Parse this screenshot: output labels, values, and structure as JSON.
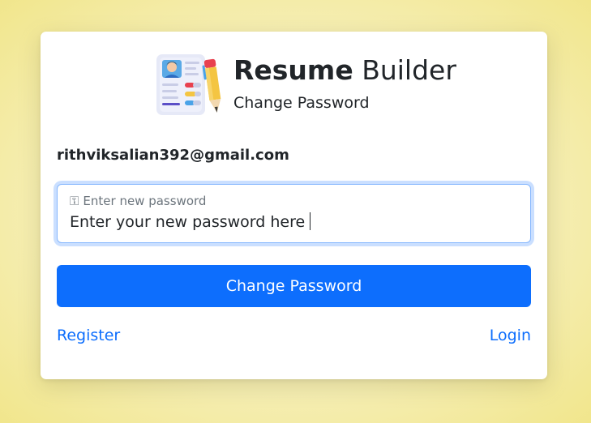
{
  "brand": {
    "title_bold": "Resume",
    "title_light": "Builder",
    "subtitle": "Change Password",
    "logo_icon": "resume-document-pencil-icon"
  },
  "form": {
    "email": "rithviksalian392@gmail.com",
    "password_label_icon": "key-icon",
    "password_label": "Enter new password",
    "password_value": "Enter your new password here",
    "submit_label": "Change Password"
  },
  "links": {
    "register": "Register",
    "login": "Login"
  },
  "colors": {
    "primary": "#0d6efd",
    "background": "#f6efb8",
    "text": "#212529"
  }
}
